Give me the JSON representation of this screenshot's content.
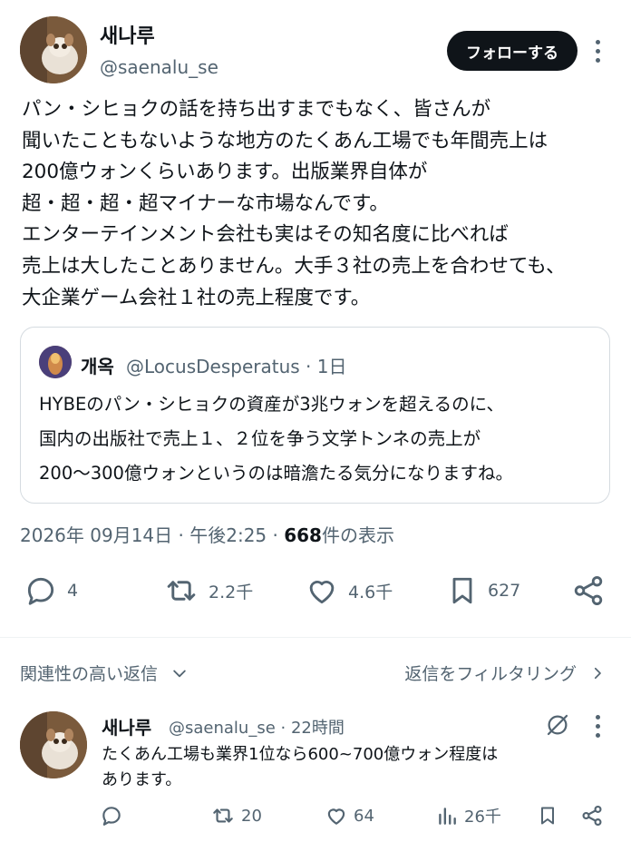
{
  "author": {
    "name": "새나루",
    "handle": "@saenalu_se",
    "follow_label": "フォローする"
  },
  "tweet": {
    "lines": [
      "パン・シヒョクの話を持ち出すまでもなく、皆さんが",
      "聞いたこともないような地方のたくあん工場でも年間売上は",
      "200億ウォンくらいあります。出版業界自体が",
      "超・超・超・超マイナーな市場なんです。",
      "エンターテインメント会社も実はその知名度に比べれば",
      "売上は大したことありません。大手３社の売上を合わせても、",
      "大企業ゲーム会社１社の売上程度です。"
    ]
  },
  "quote": {
    "name": "개옥",
    "handle_time": "@LocusDesperatus · 1日",
    "lines": [
      "HYBEのパン・シヒョクの資産が3兆ウォンを超えるのに、",
      "国内の出版社で売上１、２位を争う文学トンネの売上が",
      "200〜300億ウォンというのは暗澹たる気分になりますね。"
    ]
  },
  "meta": {
    "datetime": "2026年 09月14日 · 午後2:25 · ",
    "views_count": "668",
    "views_label": "件の表示"
  },
  "actions": {
    "replies": "4",
    "reposts": "2.2千",
    "likes": "4.6千",
    "bookmarks": "627"
  },
  "replies_header": {
    "sort_label": "関連性の高い返信",
    "filter_label": "返信をフィルタリング"
  },
  "reply": {
    "name": "새나루",
    "handle_time": "@saenalu_se · 22時間",
    "lines": [
      "たくあん工場も業界1位なら600~700億ウォン程度は",
      "あります。"
    ],
    "actions": {
      "reposts": "20",
      "likes": "64",
      "views": "26千"
    }
  },
  "colors": {
    "text": "#0f1419",
    "secondary": "#536471",
    "border": "#d5dbe0",
    "button": "#0f1419"
  }
}
